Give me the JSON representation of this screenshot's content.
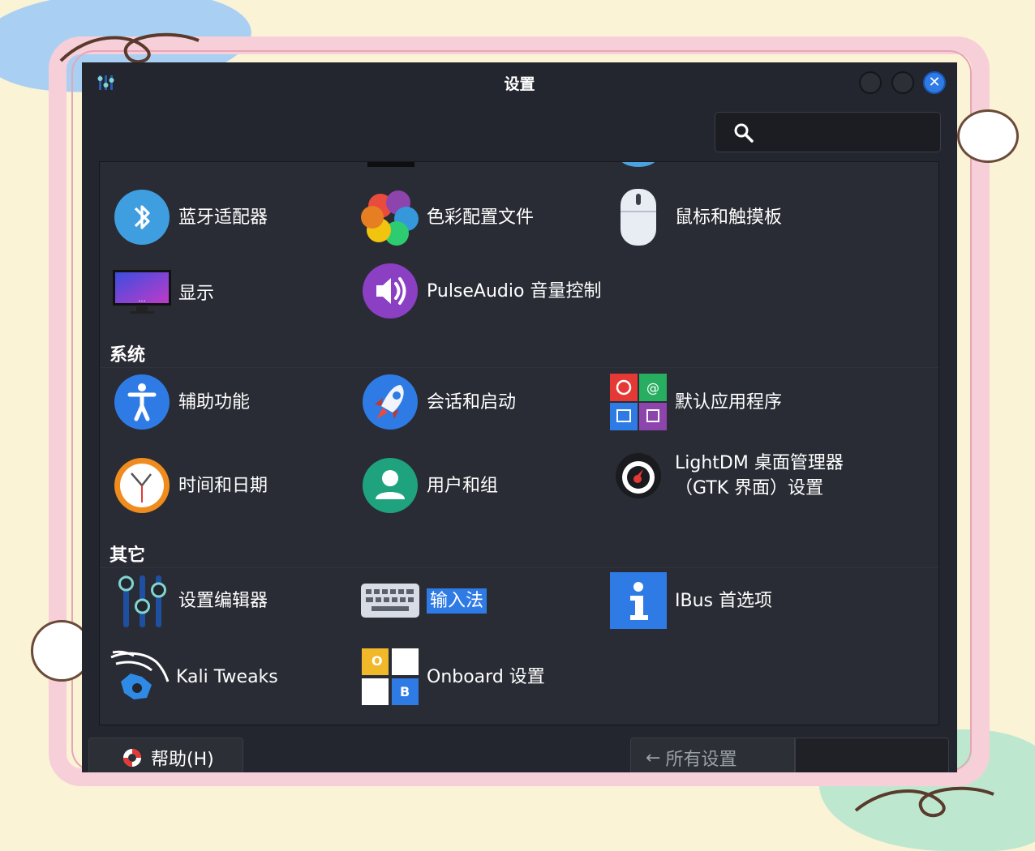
{
  "window": {
    "title": "设置"
  },
  "search": {
    "placeholder": ""
  },
  "sections": {
    "system": "系统",
    "other": "其它"
  },
  "items": {
    "bluetooth": "蓝牙适配器",
    "color": "色彩配置文件",
    "mouse": "鼠标和触摸板",
    "display": "显示",
    "pulseaudio": "PulseAudio 音量控制",
    "accessibility": "辅助功能",
    "session": "会话和启动",
    "default_apps": "默认应用程序",
    "datetime": "时间和日期",
    "users": "用户和组",
    "lightdm": "LightDM 桌面管理器（GTK 界面）设置",
    "settings_editor": "设置编辑器",
    "input_method": "输入法",
    "ibus": "IBus 首选项",
    "kali_tweaks": "Kali Tweaks",
    "onboard": "Onboard 设置"
  },
  "buttons": {
    "help": "帮助(H)",
    "all_settings": "所有设置"
  },
  "colors": {
    "window_bg": "#23262e",
    "panel_bg": "#292c34",
    "accent": "#2f7be6"
  }
}
